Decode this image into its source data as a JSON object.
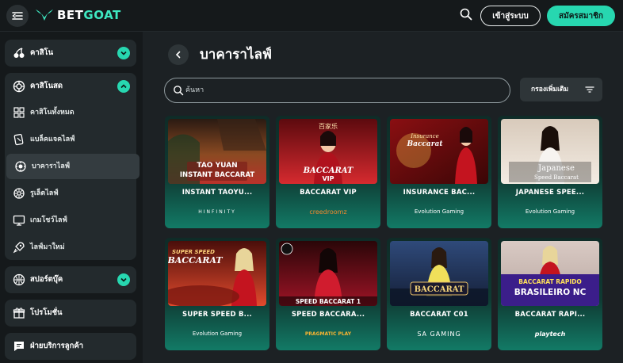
{
  "header": {
    "logo_text_a": "BET",
    "logo_text_b": "GOAT",
    "login_label": "เข้าสู่ระบบ",
    "signup_label": "สมัครสมาชิก",
    "icons": [
      "menu-collapse-icon",
      "goat-logo-icon",
      "search-icon"
    ]
  },
  "sidebar": {
    "casino": {
      "label": "คาสิโน",
      "icon": "cherry-icon"
    },
    "live_casino": {
      "label": "คาสิโนสด",
      "icon": "casino-chip-icon",
      "items": [
        {
          "label": "คาสิโนทั้งหมด",
          "icon": "grid-icon"
        },
        {
          "label": "แบล็คแจคไลฟ์",
          "icon": "cards-icon"
        },
        {
          "label": "บาคาราไลฟ์",
          "icon": "chip-icon",
          "active": true
        },
        {
          "label": "รูเล็ตไลฟ์",
          "icon": "roulette-icon"
        },
        {
          "label": "เกมโชว์ไลฟ์",
          "icon": "monitor-icon"
        },
        {
          "label": "ไลฟ์มาใหม่",
          "icon": "rocket-icon"
        }
      ]
    },
    "sports": {
      "label": "สปอร์ตบุ๊ค",
      "icon": "basketball-icon"
    },
    "promotions": {
      "label": "โปรโมชั่น",
      "icon": "gift-icon"
    },
    "support": {
      "label": "ฝ่ายบริการลูกค้า",
      "icon": "chat-icon"
    }
  },
  "main": {
    "title": "บาคาราไลฟ์",
    "search_placeholder": "ค้นหา",
    "filter_label": "กรองเพิ่มเติม"
  },
  "games": [
    {
      "name": "INSTANT TAOYU...",
      "provider": "HINFINITY",
      "thumb_text": "TAO YUAN\nINSTANT BACCARAT",
      "colors": [
        "#6b3a1e",
        "#c0392b"
      ]
    },
    {
      "name": "BACCARAT VIP",
      "provider": "creedroomz",
      "thumb_text": "百家乐\nBACCARAT VIP",
      "colors": [
        "#7a0e12",
        "#d21f2b"
      ]
    },
    {
      "name": "INSURANCE BAC...",
      "provider": "Evolution Gaming",
      "thumb_text": "Insurance Baccarat",
      "colors": [
        "#8a0f12",
        "#f2c14a"
      ]
    },
    {
      "name": "JAPANESE SPEE...",
      "provider": "Evolution Gaming",
      "thumb_text": "Japanese\nSpeed Baccarat",
      "colors": [
        "#c9b9a6",
        "#f0e6da"
      ]
    },
    {
      "name": "SUPER SPEED B...",
      "provider": "Evolution Gaming",
      "thumb_text": "SUPER SPEED\nBACCARAT",
      "colors": [
        "#7c1a12",
        "#e24a2d"
      ]
    },
    {
      "name": "SPEED BACCARA...",
      "provider": "PRAGMATIC PLAY",
      "thumb_text": "SPEED BACCARAT 1",
      "colors": [
        "#3a0a0e",
        "#b0162a"
      ]
    },
    {
      "name": "BACCARAT C01",
      "provider": "SA GAMING",
      "thumb_text": "BACCARAT",
      "colors": [
        "#1d2a4a",
        "#3a5c8f"
      ]
    },
    {
      "name": "BACCARAT RAPI...",
      "provider": "playtech",
      "thumb_text": "BACCARAT RAPIDO\nBRASILEIRO NC",
      "colors": [
        "#3b1e8a",
        "#d9c7c2"
      ]
    }
  ]
}
